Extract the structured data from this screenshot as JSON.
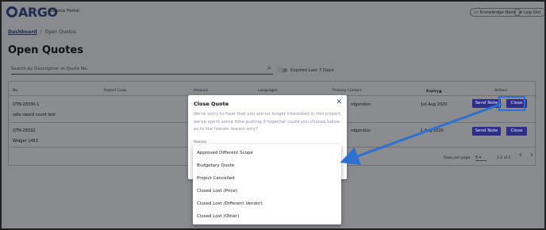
{
  "header": {
    "logo_text": "ARGO",
    "portal_label": "Service Portal",
    "knowledge_base_label": "Knowledge Base",
    "logout_label": "Log Out"
  },
  "breadcrumb": {
    "home": "Dashboard",
    "separator": "/",
    "current": "Open Quotes"
  },
  "page_title": "Open Quotes",
  "search": {
    "placeholder": "Search by Description or Quote No."
  },
  "toggle": {
    "label": "Expired Last 7 Days",
    "on": false
  },
  "table": {
    "columns": [
      "No",
      "Project Code",
      "Amount",
      "Languages",
      "Primary Contact",
      "Expiry",
      "Actions"
    ],
    "rows": [
      {
        "no": "QTN-28330-1",
        "description": "odio sword count test",
        "contact": "rdgondizo",
        "expiry": "1st Aug 2020",
        "send_label": "Send Note",
        "close_label": "Close"
      },
      {
        "no": "QTN-28332",
        "description": "Widget 1453",
        "contact": "rdgondizo",
        "expiry": "1 Aug 2020",
        "send_label": "Send Note",
        "close_label": "Close"
      }
    ],
    "pager": {
      "rows_per_page_label": "Rows per page:",
      "rows_per_page_value": "5",
      "range": "1-2 of 2"
    }
  },
  "modal": {
    "title": "Close Quote",
    "body": "We're sorry to hear that you are no longer interested in this project, we've spent some time putting it together could you choose below as to the reason reason why?",
    "reason_label": "Reason",
    "options": [
      "Approved Different Scope",
      "Budgetary Quote",
      "Project Cancelled",
      "Closed Lost (Price)",
      "Closed Lost (Different Vendor)",
      "Closed Lost (Other)"
    ]
  },
  "colors": {
    "brand": "#1f2a52",
    "button": "#2c2e8a",
    "annotation": "#2e6fd0"
  },
  "icons": {
    "search": "search-icon",
    "close": "close-icon",
    "knowledge": "book-icon",
    "logout": "logout-icon"
  }
}
